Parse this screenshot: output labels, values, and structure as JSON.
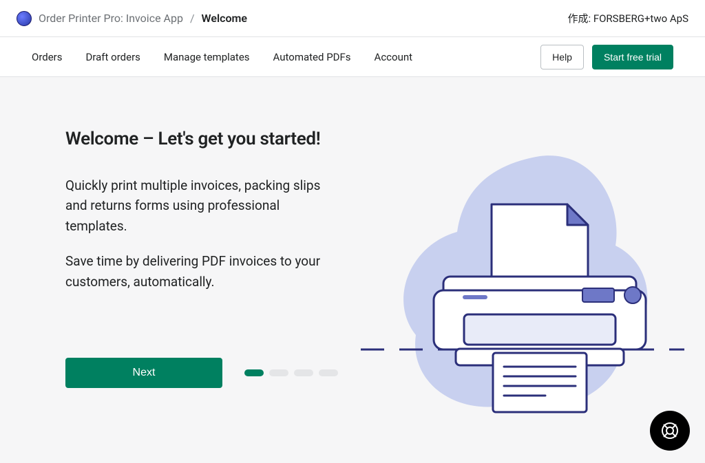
{
  "header": {
    "app_name": "Order Printer Pro: Invoice App",
    "separator": "/",
    "current_page": "Welcome",
    "right_text": "作成: FORSBERG+two ApS"
  },
  "nav": {
    "items": [
      "Orders",
      "Draft orders",
      "Manage templates",
      "Automated PDFs",
      "Account"
    ],
    "help_label": "Help",
    "trial_label": "Start free trial"
  },
  "welcome": {
    "title": "Welcome – Let's get you started!",
    "p1": "Quickly print multiple invoices, packing slips and returns forms using professional templates.",
    "p2": "Save time by delivering PDF invoices to your customers, automatically.",
    "next_label": "Next",
    "steps_total": 4,
    "step_active": 1
  },
  "colors": {
    "primary": "#008060",
    "border": "#e1e3e5",
    "bg": "#f6f6f7",
    "illu_blob": "#c8d0ef",
    "illu_stroke": "#2b2f7a",
    "illu_accent": "#6e78c7"
  }
}
